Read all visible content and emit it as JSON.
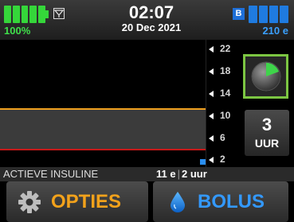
{
  "status": {
    "battery_percent": "100%",
    "battery_level": 1.0,
    "signal_icon": "antenna-icon",
    "time": "02:07",
    "date": "20 Dec 2021",
    "reservoir_badge": "B",
    "reservoir_units": "210 e",
    "reservoir_level": 1.0
  },
  "graph": {
    "y_ticks": [
      "22",
      "18",
      "14",
      "10",
      "6",
      "2"
    ],
    "target_high": 10,
    "target_low": 4,
    "colors": {
      "high_line": "#f0a020",
      "low_line": "#c81818",
      "band": "#3b3b3b"
    }
  },
  "controls": {
    "cgm_icon": "cgm-dial-icon",
    "hours_value": "3",
    "hours_unit": "UUR"
  },
  "active_insulin": {
    "label": "ACTIEVE INSULINE",
    "units": "11 e",
    "separator": "|",
    "duration": "2 uur"
  },
  "buttons": {
    "options_label": "OPTIES",
    "options_icon": "gear-icon",
    "bolus_label": "BOLUS",
    "bolus_icon": "drop-icon"
  },
  "theme": {
    "battery_green": "#35d63a",
    "reservoir_blue": "#1f7be0",
    "options_orange": "#f3a21b",
    "bolus_blue": "#3399ff",
    "cgm_border": "#7cc642"
  }
}
